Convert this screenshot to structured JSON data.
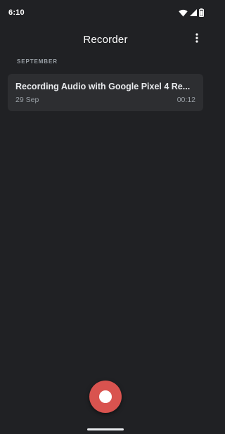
{
  "status_bar": {
    "time": "6:10",
    "icons": [
      "wifi-icon",
      "cellular-signal-icon",
      "battery-icon"
    ]
  },
  "app_bar": {
    "title": "Recorder",
    "menu_icon": "more-vert-icon"
  },
  "recordings": {
    "section_label": "SEPTEMBER",
    "items": [
      {
        "title": "Recording Audio with Google Pixel 4 Re...",
        "date": "29 Sep",
        "duration": "00:12"
      }
    ]
  },
  "record_button": {
    "icon": "record-icon",
    "color": "#d9534f"
  },
  "colors": {
    "background": "#202124",
    "card": "#2d2e31",
    "accent": "#d9534f"
  }
}
